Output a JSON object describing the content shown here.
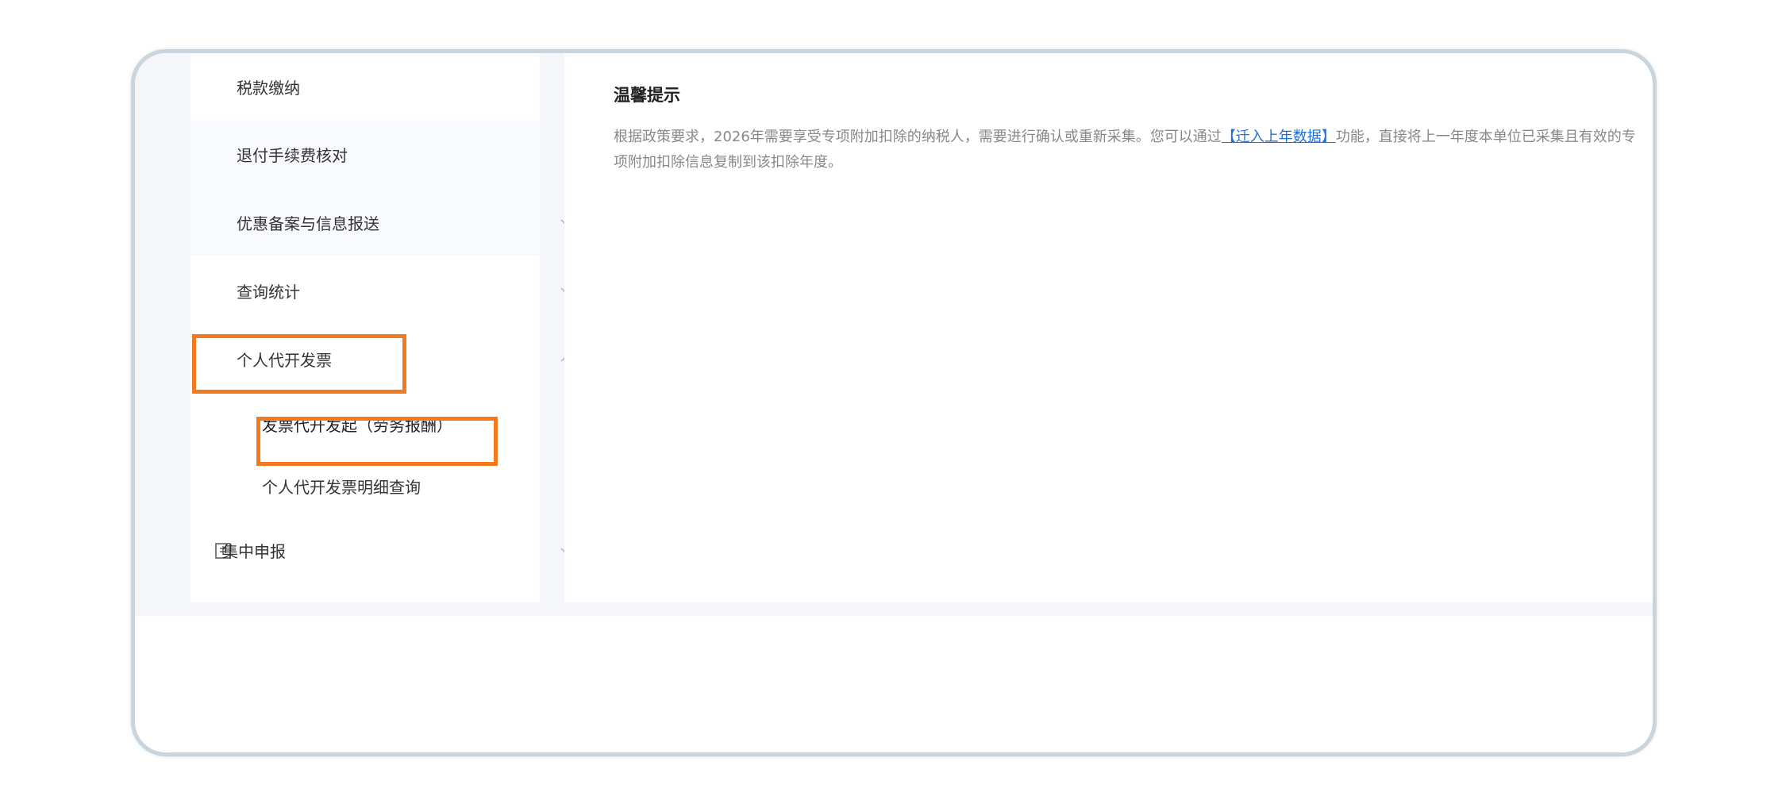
{
  "sidebar": {
    "items": [
      {
        "label": "税款缴纳"
      },
      {
        "label": "退付手续费核对"
      },
      {
        "label": "优惠备案与信息报送"
      },
      {
        "label": "查询统计"
      },
      {
        "label": "个人代开发票"
      },
      {
        "label": "发票代开发起（劳务报酬）"
      },
      {
        "label": "个人代开发票明细查询"
      },
      {
        "label": "集中申报"
      }
    ]
  },
  "notice": {
    "title": "温馨提示",
    "text_before": "根据政策要求，2026年需要享受专项附加扣除的纳税人，需要进行确认或重新采集。您可以通过",
    "link": "【迁入上年数据】",
    "text_after": "功能，直接将上一年度本单位已采集且有效的专项附加扣除信息复制到该扣除年度。"
  },
  "colors": {
    "highlight": "#f47a1f",
    "link": "#1e6fd9",
    "frame_border": "#c9d4dc"
  },
  "icons": {
    "chevron": "chevron-icon",
    "document": "document-icon"
  }
}
